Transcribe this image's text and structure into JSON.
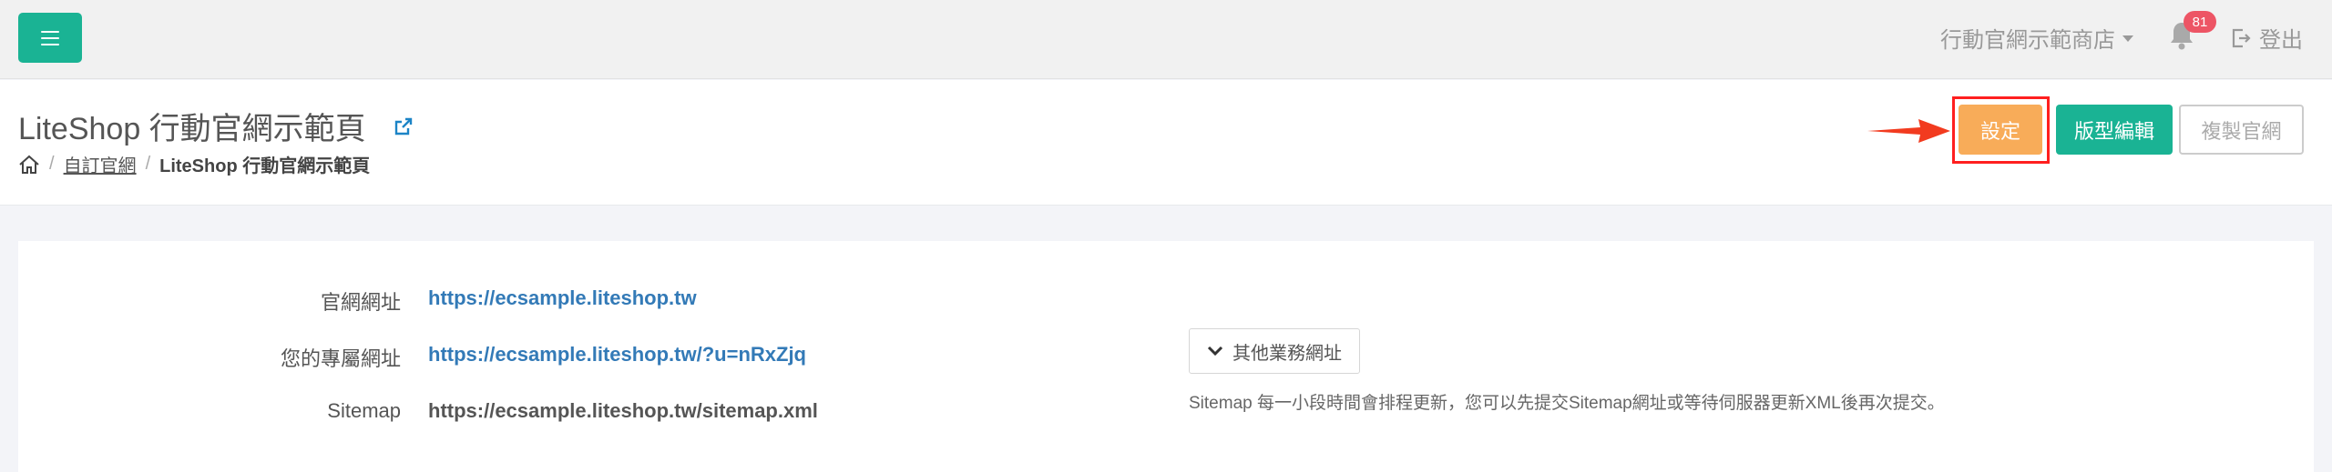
{
  "topbar": {
    "store_name": "行動官網示範商店",
    "notification_count": "81",
    "logout_label": "登出"
  },
  "header": {
    "page_title": "LiteShop 行動官網示範頁",
    "breadcrumb": {
      "level1": "自訂官網",
      "current": "LiteShop 行動官網示範頁"
    },
    "buttons": {
      "settings": "設定",
      "layout_edit": "版型編輯",
      "copy_site": "複製官網"
    }
  },
  "details": {
    "site_url_label": "官網網址",
    "site_url": "https://ecsample.liteshop.tw",
    "private_url_label": "您的專屬網址",
    "private_url": "https://ecsample.liteshop.tw/?u=nRxZjq",
    "sitemap_label": "Sitemap",
    "sitemap_url": "https://ecsample.liteshop.tw/sitemap.xml",
    "other_urls_button": "其他業務網址",
    "sitemap_note": "Sitemap 每一小段時間會排程更新，您可以先提交Sitemap網址或等待伺服器更新XML後再次提交。"
  },
  "colors": {
    "primary": "#1ab394",
    "warning": "#f8ac59",
    "danger": "#ed5565",
    "highlight": "#ff1f1f",
    "link": "#337ab7"
  }
}
